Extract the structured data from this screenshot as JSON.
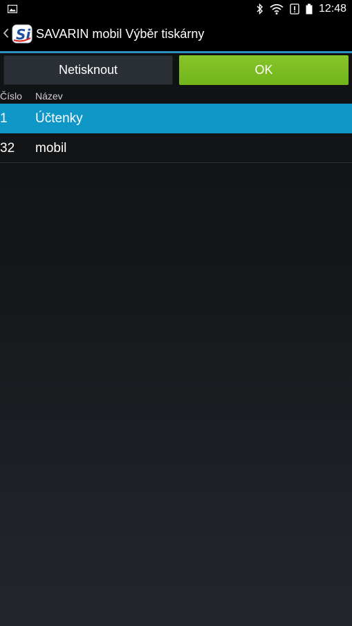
{
  "status_bar": {
    "time": "12:48",
    "icons": [
      "image-notification-icon",
      "bluetooth-icon",
      "wifi-icon",
      "alert-icon",
      "battery-icon"
    ]
  },
  "action_bar": {
    "title": "SAVARIN mobil Výběr tiskárny",
    "logo_text": "Si"
  },
  "buttons": {
    "no_print_label": "Netisknout",
    "ok_label": "OK"
  },
  "table": {
    "headers": {
      "number": "Číslo",
      "name": "Název"
    },
    "rows": [
      {
        "number": "1",
        "name": "Účtenky",
        "selected": true
      },
      {
        "number": "32",
        "name": "mobil",
        "selected": false
      }
    ]
  },
  "colors": {
    "accent": "#2f8fc0",
    "selected_row": "#0f97c8",
    "ok_button": "#7dbd22"
  }
}
